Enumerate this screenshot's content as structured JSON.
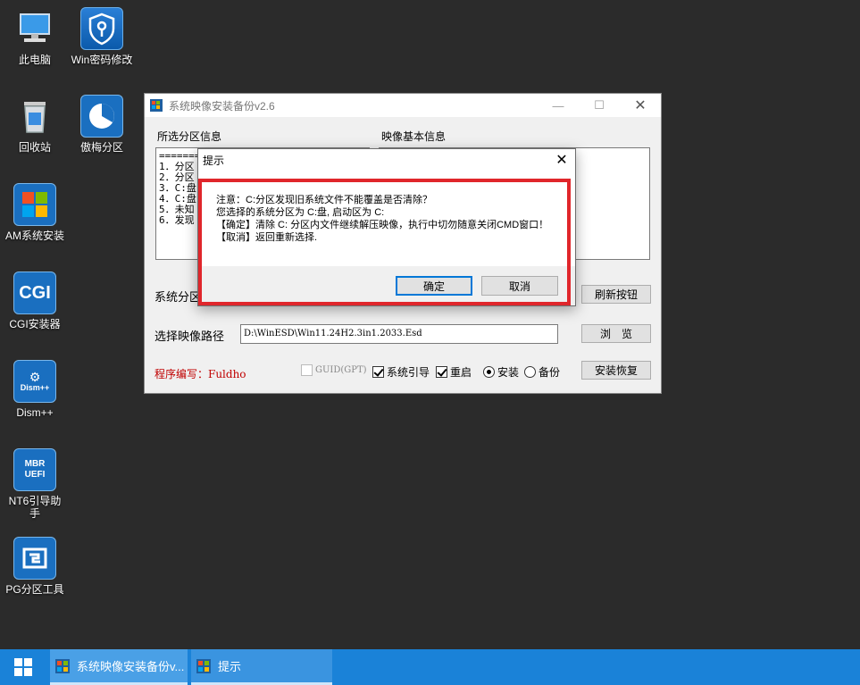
{
  "desktop": {
    "icons": [
      {
        "label": "此电脑",
        "icon": "computer-icon"
      },
      {
        "label": "Win密码修改",
        "icon": "key-shield-icon"
      },
      {
        "label": "回收站",
        "icon": "recycle-bin-icon"
      },
      {
        "label": "傲梅分区",
        "icon": "partition-pie-icon"
      },
      {
        "label": "AM系统安装",
        "icon": "windows-logo-icon"
      },
      {
        "label": "CGI安装器",
        "icon_text": "CGI",
        "icon": "cgi-icon"
      },
      {
        "label": "Dism++",
        "icon_text": "Dism++",
        "icon": "gear-icon"
      },
      {
        "label": "NT6引导助手",
        "icon_text": "MBR UEFI",
        "icon": "mbr-uefi-icon"
      },
      {
        "label": "PG分区工具",
        "icon": "pg-partition-icon"
      }
    ]
  },
  "main_window": {
    "title": "系统映像安装备份v2.6",
    "partition_info_label": "所选分区信息",
    "image_info_label": "映像基本信息",
    "partition_text": "========\n1．分区\n2．分区\n3．C:盘\n4．C:盘\n5．未知\n6．发现",
    "system_partition_label": "系统分区",
    "refresh_button": "刷新按钮",
    "image_path_label": "选择映像路径",
    "image_path_value": "D:\\WinESD\\Win11.24H2.3in1.2033.Esd",
    "browse_button": "浏　览",
    "author": "程序编写：Fuldho",
    "options": {
      "guid": "GUID(GPT)",
      "boot": "系统引导",
      "restart": "重启",
      "install": "安装",
      "backup": "备份"
    },
    "install_restore_button": "安装恢复"
  },
  "dialog": {
    "title": "提示",
    "lines": [
      "注意：C:分区发现旧系统文件不能覆盖是否清除？",
      "您选择的系统分区为 C:盘, 启动区为 C:",
      "【确定】清除 C: 分区内文件继续解压映像，执行中切勿随意关闭CMD窗口！",
      "【取消】返回重新选择."
    ],
    "ok_button": "确定",
    "cancel_button": "取消",
    "highlight_color": "#e0262b"
  },
  "taskbar": {
    "tasks": [
      {
        "label": "系统映像安装备份v..."
      },
      {
        "label": "提示"
      }
    ],
    "color": "#1a82d8"
  }
}
